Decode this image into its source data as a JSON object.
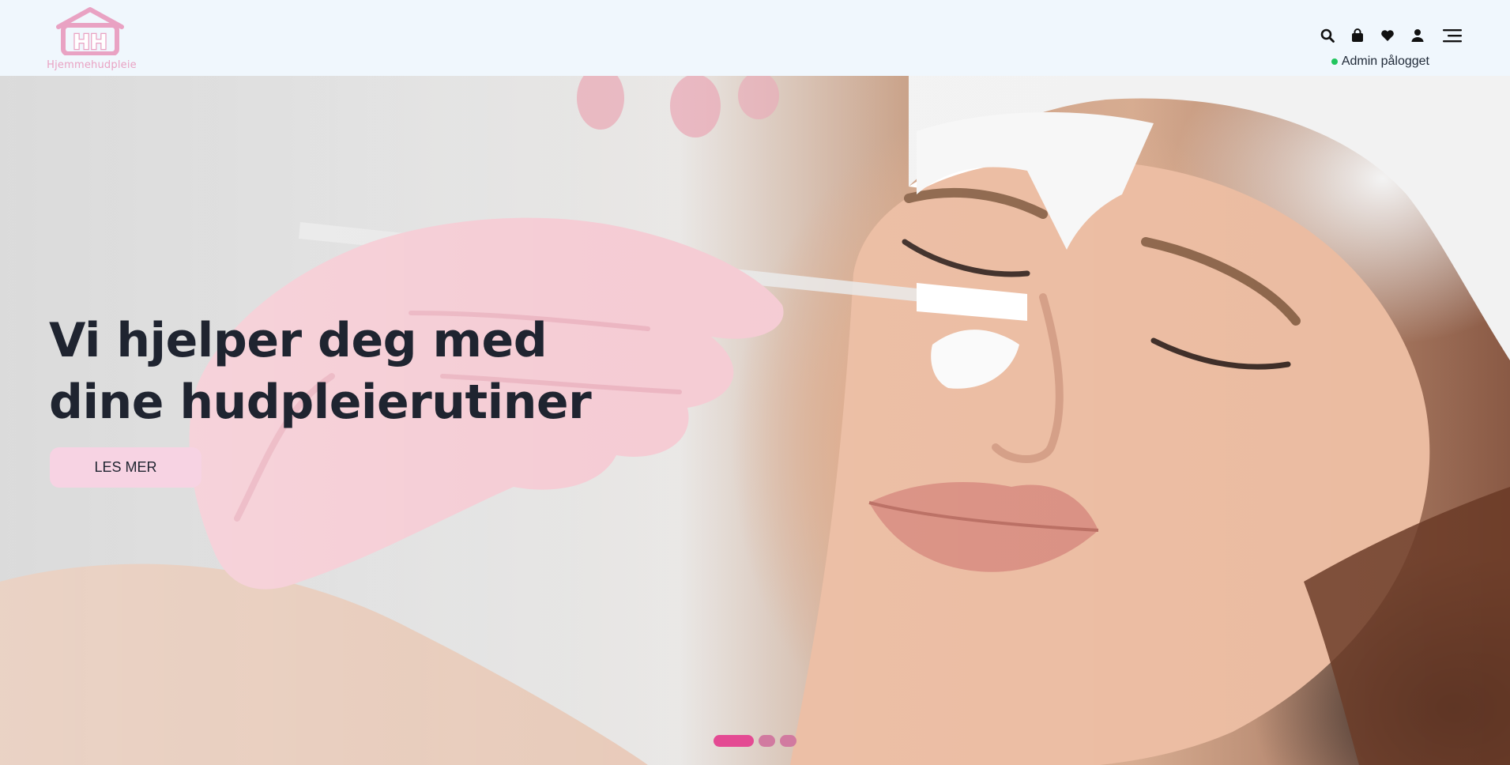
{
  "brand": {
    "logo_initials": "HH",
    "name": "Hjemmehudpleie",
    "color": "#e9a2c3"
  },
  "nav": {
    "icons": [
      "search-icon",
      "shopping-bag-icon",
      "heart-icon",
      "user-icon",
      "menu-icon"
    ]
  },
  "status": {
    "text": "Admin pålogget",
    "dot_color": "#22c55e"
  },
  "hero": {
    "title_line1": "Vi hjelper deg med",
    "title_line2": "dine hudpleierutiner",
    "button_label": "LES MER",
    "button_color": "#f7d3e3"
  },
  "carousel": {
    "slide_count": 3,
    "active_index": 0,
    "active_color": "#e44a93",
    "inactive_color": "#d17aa0"
  }
}
